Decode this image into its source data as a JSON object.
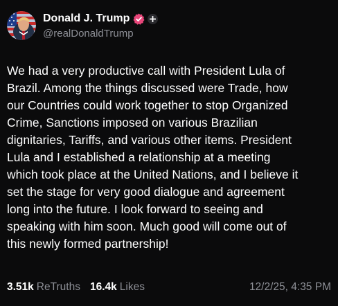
{
  "author": {
    "display_name": "Donald J. Trump",
    "handle": "@realDonaldTrump",
    "avatar_icon": "flag-portrait-avatar",
    "verified_icon": "verified-badge-icon",
    "verified_color": "#e8467a",
    "follow_icon": "plus-icon"
  },
  "post": {
    "lines": [
      "We had a very productive call with President Lula of",
      "Brazil. Among the things discussed were Trade, how",
      "our Countries could work together to stop Organized",
      "Crime, Sanctions imposed on various Brazilian",
      "dignitaries, Tariffs, and various other items. President",
      "Lula and I established a relationship at a meeting",
      "which took place at the United Nations, and I believe it",
      "set the stage for very good dialogue and agreement",
      "long into the future. I look forward to seeing and",
      "speaking with him soon. Much good will come out of",
      "this newly formed partnership!"
    ]
  },
  "stats": {
    "retruths_count": "3.51k",
    "retruths_label": "ReTruths",
    "likes_count": "16.4k",
    "likes_label": "Likes",
    "timestamp": "12/2/25, 4:35 PM"
  },
  "colors": {
    "background": "#0b0b0c",
    "text": "#ffffff",
    "muted": "#8d8f96"
  }
}
